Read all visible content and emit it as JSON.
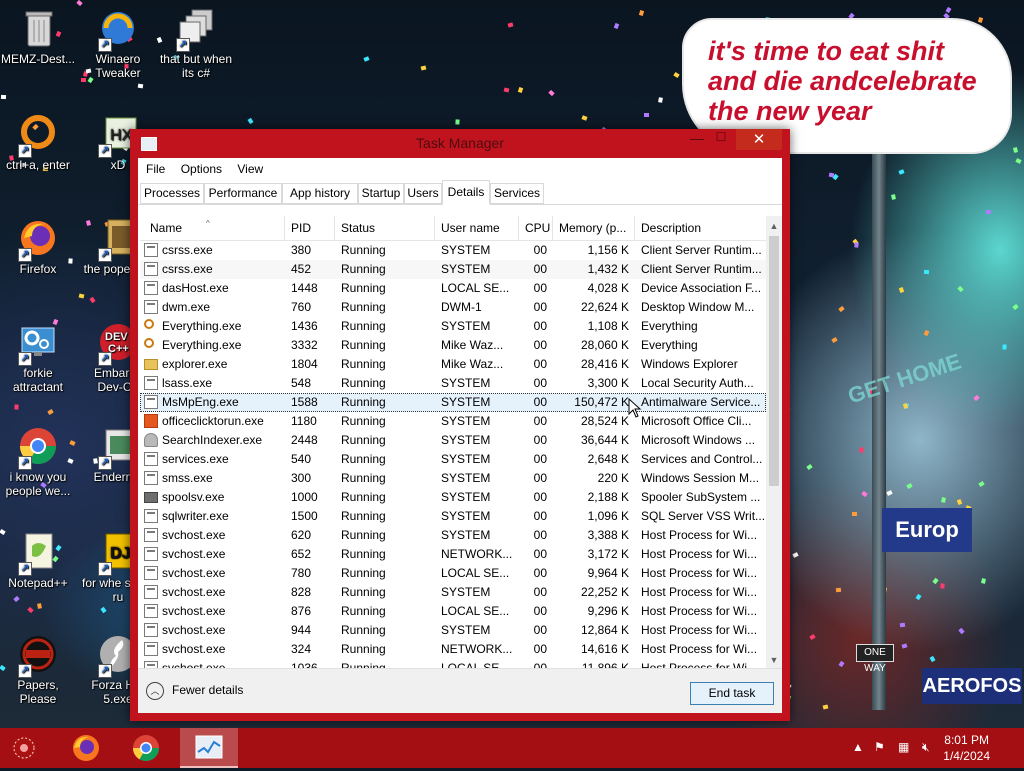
{
  "desktop": {
    "billboard_text": "it's time to eat shit\nand die andcelebrate\nthe new year",
    "signs": {
      "home": "GET HOME",
      "europ": "Europ",
      "aero": "AEROFOS",
      "one": "ONE WAY"
    },
    "icons": [
      {
        "name": "recycle-bin",
        "label": "MEMZ-Dest..."
      },
      {
        "name": "winaero-tweaker",
        "label": "Winaero Tweaker"
      },
      {
        "name": "that-but-when-csharp",
        "label": "that but when its c#"
      },
      {
        "name": "ctrl-a-enter",
        "label": "ctrl+a, enter"
      },
      {
        "name": "xd",
        "label": "xD"
      },
      {
        "name": "firefox-desktop",
        "label": "Firefox"
      },
      {
        "name": "the-pope",
        "label": "the pope shit"
      },
      {
        "name": "forkie-attractant",
        "label": "forkie attractant"
      },
      {
        "name": "embarcadero-devcpp",
        "label": "Embarca Dev-C+"
      },
      {
        "name": "i-know-you",
        "label": "i know you people we..."
      },
      {
        "name": "enderman",
        "label": "Enderma"
      },
      {
        "name": "notepad-plus-plus",
        "label": "Notepad++"
      },
      {
        "name": "for-when",
        "label": "for whe some ru"
      },
      {
        "name": "papers-please",
        "label": "Papers, Please"
      },
      {
        "name": "forza-horizon",
        "label": "Forza Hor 5.exe"
      }
    ]
  },
  "window": {
    "title": "Task Manager",
    "menus": [
      "File",
      "Options",
      "View"
    ],
    "tabs": [
      "Processes",
      "Performance",
      "App history",
      "Startup",
      "Users",
      "Details",
      "Services"
    ],
    "active_tab": "Details",
    "columns": [
      "Name",
      "PID",
      "Status",
      "User name",
      "CPU",
      "Memory (p...",
      "Description"
    ],
    "rows": [
      {
        "icon": "app",
        "name": "csrss.exe",
        "pid": "380",
        "status": "Running",
        "user": "SYSTEM",
        "cpu": "00",
        "mem": "1,156 K",
        "desc": "Client Server Runtim..."
      },
      {
        "icon": "app",
        "name": "csrss.exe",
        "pid": "452",
        "status": "Running",
        "user": "SYSTEM",
        "cpu": "00",
        "mem": "1,432 K",
        "desc": "Client Server Runtim..."
      },
      {
        "icon": "app",
        "name": "dasHost.exe",
        "pid": "1448",
        "status": "Running",
        "user": "LOCAL SE...",
        "cpu": "00",
        "mem": "4,028 K",
        "desc": "Device Association F..."
      },
      {
        "icon": "app",
        "name": "dwm.exe",
        "pid": "760",
        "status": "Running",
        "user": "DWM-1",
        "cpu": "00",
        "mem": "22,624 K",
        "desc": "Desktop Window M..."
      },
      {
        "icon": "search",
        "name": "Everything.exe",
        "pid": "1436",
        "status": "Running",
        "user": "SYSTEM",
        "cpu": "00",
        "mem": "1,108 K",
        "desc": "Everything"
      },
      {
        "icon": "search",
        "name": "Everything.exe",
        "pid": "3332",
        "status": "Running",
        "user": "Mike Waz...",
        "cpu": "00",
        "mem": "28,060 K",
        "desc": "Everything"
      },
      {
        "icon": "folder",
        "name": "explorer.exe",
        "pid": "1804",
        "status": "Running",
        "user": "Mike Waz...",
        "cpu": "00",
        "mem": "28,416 K",
        "desc": "Windows Explorer"
      },
      {
        "icon": "app",
        "name": "lsass.exe",
        "pid": "548",
        "status": "Running",
        "user": "SYSTEM",
        "cpu": "00",
        "mem": "3,300 K",
        "desc": "Local Security Auth..."
      },
      {
        "icon": "app",
        "name": "MsMpEng.exe",
        "pid": "1588",
        "status": "Running",
        "user": "SYSTEM",
        "cpu": "00",
        "mem": "150,472 K",
        "desc": "Antimalware Service..."
      },
      {
        "icon": "office",
        "name": "officeclicktorun.exe",
        "pid": "1180",
        "status": "Running",
        "user": "SYSTEM",
        "cpu": "00",
        "mem": "28,524 K",
        "desc": "Microsoft Office Cli..."
      },
      {
        "icon": "person",
        "name": "SearchIndexer.exe",
        "pid": "2448",
        "status": "Running",
        "user": "SYSTEM",
        "cpu": "00",
        "mem": "36,644 K",
        "desc": "Microsoft Windows ..."
      },
      {
        "icon": "app",
        "name": "services.exe",
        "pid": "540",
        "status": "Running",
        "user": "SYSTEM",
        "cpu": "00",
        "mem": "2,648 K",
        "desc": "Services and Control..."
      },
      {
        "icon": "app",
        "name": "smss.exe",
        "pid": "300",
        "status": "Running",
        "user": "SYSTEM",
        "cpu": "00",
        "mem": "220 K",
        "desc": "Windows Session M..."
      },
      {
        "icon": "printer",
        "name": "spoolsv.exe",
        "pid": "1000",
        "status": "Running",
        "user": "SYSTEM",
        "cpu": "00",
        "mem": "2,188 K",
        "desc": "Spooler SubSystem ..."
      },
      {
        "icon": "app",
        "name": "sqlwriter.exe",
        "pid": "1500",
        "status": "Running",
        "user": "SYSTEM",
        "cpu": "00",
        "mem": "1,096 K",
        "desc": "SQL Server VSS Writ..."
      },
      {
        "icon": "app",
        "name": "svchost.exe",
        "pid": "620",
        "status": "Running",
        "user": "SYSTEM",
        "cpu": "00",
        "mem": "3,388 K",
        "desc": "Host Process for Wi..."
      },
      {
        "icon": "app",
        "name": "svchost.exe",
        "pid": "652",
        "status": "Running",
        "user": "NETWORK...",
        "cpu": "00",
        "mem": "3,172 K",
        "desc": "Host Process for Wi..."
      },
      {
        "icon": "app",
        "name": "svchost.exe",
        "pid": "780",
        "status": "Running",
        "user": "LOCAL SE...",
        "cpu": "00",
        "mem": "9,964 K",
        "desc": "Host Process for Wi..."
      },
      {
        "icon": "app",
        "name": "svchost.exe",
        "pid": "828",
        "status": "Running",
        "user": "SYSTEM",
        "cpu": "00",
        "mem": "22,252 K",
        "desc": "Host Process for Wi..."
      },
      {
        "icon": "app",
        "name": "svchost.exe",
        "pid": "876",
        "status": "Running",
        "user": "LOCAL SE...",
        "cpu": "00",
        "mem": "9,296 K",
        "desc": "Host Process for Wi..."
      },
      {
        "icon": "app",
        "name": "svchost.exe",
        "pid": "944",
        "status": "Running",
        "user": "SYSTEM",
        "cpu": "00",
        "mem": "12,864 K",
        "desc": "Host Process for Wi..."
      },
      {
        "icon": "app",
        "name": "svchost.exe",
        "pid": "324",
        "status": "Running",
        "user": "NETWORK...",
        "cpu": "00",
        "mem": "14,616 K",
        "desc": "Host Process for Wi..."
      },
      {
        "icon": "app",
        "name": "svchost.exe",
        "pid": "1036",
        "status": "Running",
        "user": "LOCAL SE...",
        "cpu": "00",
        "mem": "11,896 K",
        "desc": "Host Process for Wi..."
      }
    ],
    "selected_row": "MsMpEng.exe",
    "footer": {
      "fewer_details": "Fewer details",
      "end_task": "End task"
    }
  },
  "taskbar": {
    "apps": [
      "start-button",
      "firefox",
      "chrome",
      "task-manager"
    ],
    "active_app": "task-manager",
    "time": "8:01 PM",
    "date": "1/4/2024"
  },
  "colors": {
    "window_frame": "#c0131d",
    "taskbar": "#a30f12",
    "selection": "#e5f1fb",
    "billboard_text": "#c8102e"
  }
}
